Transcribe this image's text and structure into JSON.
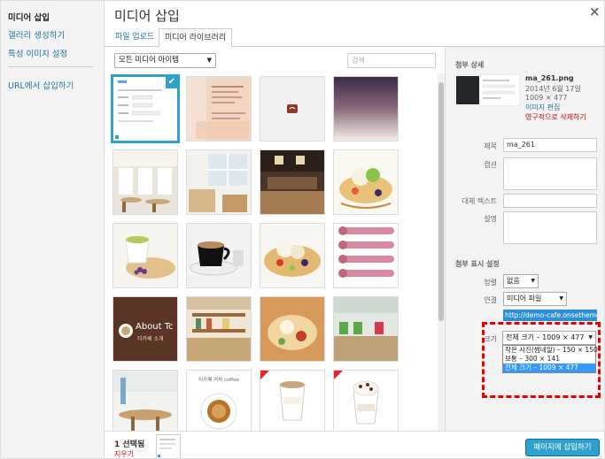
{
  "menu": {
    "items": [
      {
        "label": "미디어 삽입",
        "active": true
      },
      {
        "label": "갤러리 생성하기"
      },
      {
        "label": "특성 이미지 설정"
      },
      {
        "label": "URL에서 삽입하기"
      }
    ]
  },
  "title": "미디어 삽입",
  "close_icon": "×",
  "tabs": [
    {
      "label": "파일 업로드"
    },
    {
      "label": "미디어 라이브러리",
      "active": true
    }
  ],
  "toolbar": {
    "filter_value": "모든 미디어 아이템",
    "search_placeholder": "검색"
  },
  "sidebar": {
    "attachment_heading": "첨부 상세",
    "file_name": "ma_261.png",
    "date": "2014년 6월 17일",
    "dimensions": "1009 × 477",
    "edit_link": "이미지 편집",
    "delete_link": "영구적으로 삭제하기",
    "title_label": "제목",
    "title_value": "ma_261",
    "caption_label": "캡션",
    "alt_label": "대체 텍스트",
    "desc_label": "설명",
    "display_heading": "첨부 표시 설정",
    "align_label": "정렬",
    "align_value": "없음",
    "link_label": "연결",
    "link_value": "미디어 파일",
    "url_value": "http://demo-cafe.onsetheme",
    "size_label": "크기",
    "size_value": "전체 크기 – 1009 × 477",
    "size_options": [
      "작은 사진(썸네일) – 150 × 150",
      "보통 – 300 × 141",
      "전체 크기 – 1009 × 477"
    ]
  },
  "footer": {
    "selected_count": "1 선택됨",
    "clear_link": "지우기",
    "insert_button": "페이지에 삽입하기"
  },
  "thumbnails": {
    "about_text": "About Tc",
    "about_sub": "티카페 소개",
    "coffee_title": "티카페 커피 coffee"
  }
}
